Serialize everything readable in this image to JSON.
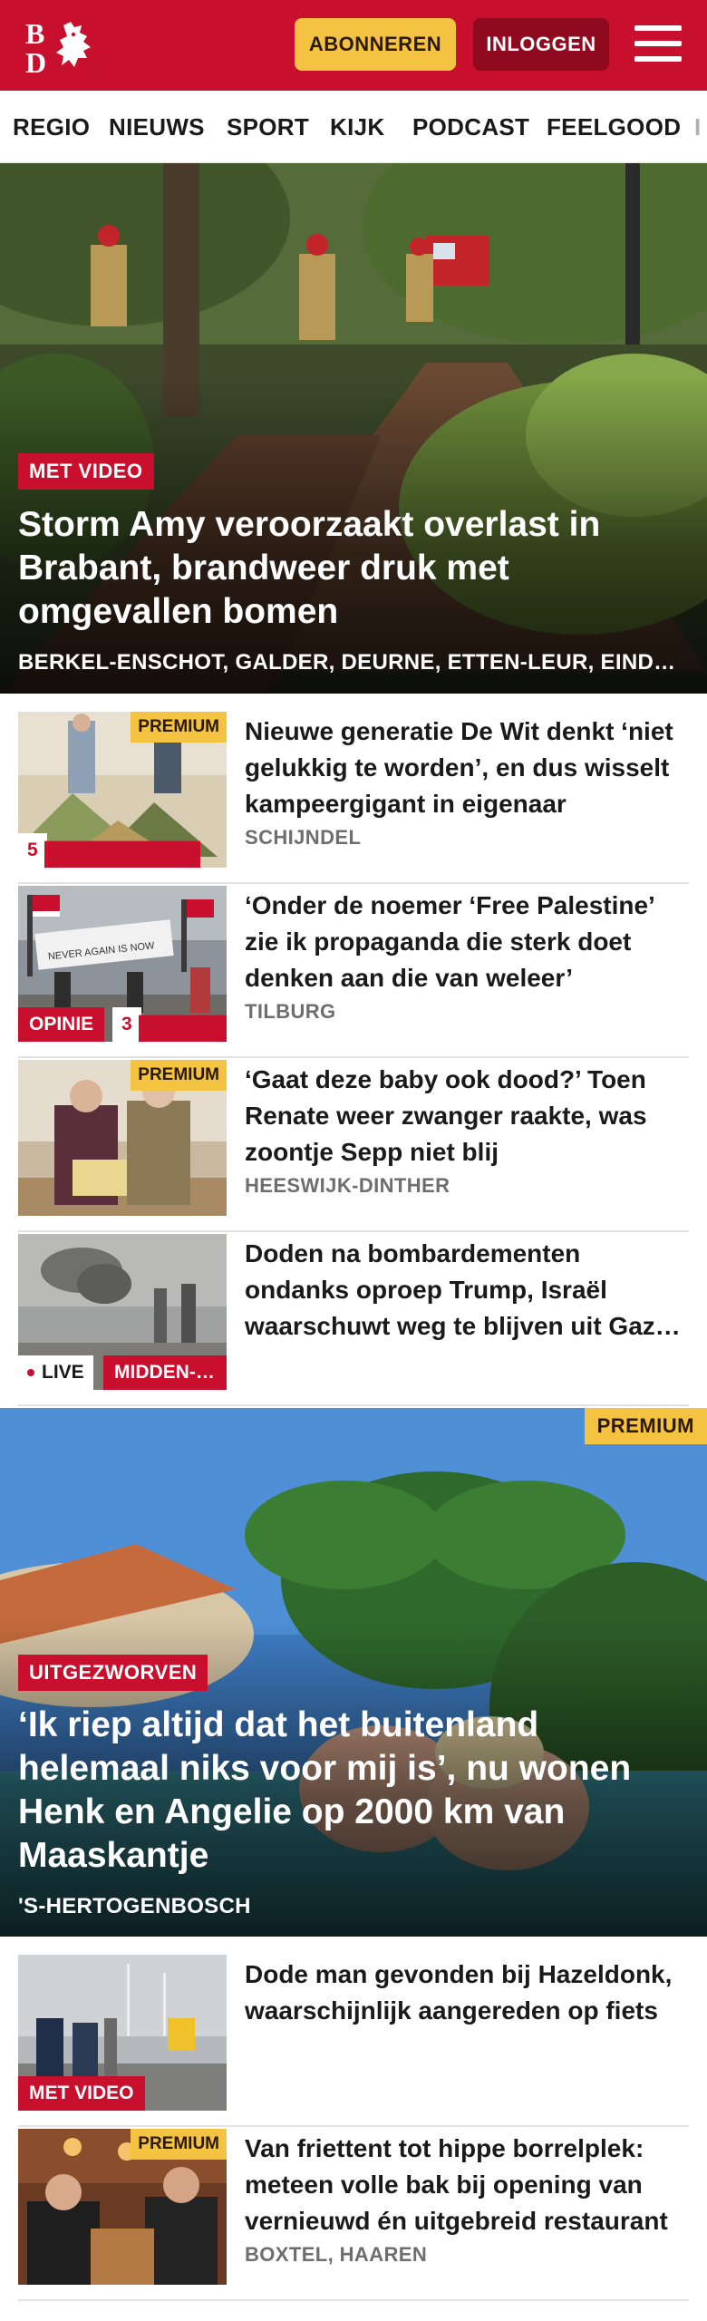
{
  "header": {
    "logo_text": "BD",
    "subscribe_label": "ABONNEREN",
    "login_label": "INLOGGEN"
  },
  "nav": {
    "items": [
      "REGIO",
      "NIEUWS",
      "SPORT",
      "KIJK",
      "PODCAST",
      "FEELGOOD",
      "I"
    ]
  },
  "hero": {
    "label": "MET VIDEO",
    "title": "Storm Amy veroorzaakt overlast in Brabant, brandweer druk met omgevallen bomen",
    "locations": "BERKEL-ENSCHOT, GALDER, DEURNE, ETTEN-LEUR, EINDHOVEN"
  },
  "articles": [
    {
      "title": "Nieuwe generatie De Wit denkt ‘niet gelukkig te worden’, en dus wisselt kampeergigant in eigenaar",
      "location": "SCHIJNDEL",
      "premium": "PREMIUM",
      "comments": "5"
    },
    {
      "title": "‘Onder de noemer ‘Free Palestine’ zie ik propaganda die sterk doet denken aan die van weleer’",
      "location": "TILBURG",
      "tag": "OPINIE",
      "comments": "3"
    },
    {
      "title": "‘Gaat deze baby ook dood?’ Toen Renate weer zwanger raakte, was zoontje Sepp niet blij",
      "location": "HEESWIJK-DINTHER",
      "premium": "PREMIUM"
    },
    {
      "title": "Doden na bombardementen ondanks oproep Trump, Israël waarschuwt weg te blijven uit Gaza-Stad",
      "location": "",
      "live": "LIVE",
      "region": "MIDDEN-OOSTEN"
    }
  ],
  "hero2": {
    "premium": "PREMIUM",
    "label": "UITGEZWORVEN",
    "title": "‘Ik riep altijd dat het buitenland helemaal niks voor mij is’, nu wonen Henk en Angelie op 2000 km van Maaskantje",
    "location": "'S-HERTOGENBOSCH"
  },
  "articles2": [
    {
      "title": "Dode man gevonden bij Hazeldonk, waarschijnlijk aangereden op fiets",
      "location": "",
      "video": "MET VIDEO"
    },
    {
      "title": "Van friettent tot hippe borrelplek: meteen volle bak bij opening van vernieuwd én uitgebreid restaurant",
      "location": "BOXTEL, HAAREN",
      "premium": "PREMIUM"
    }
  ],
  "colors": {
    "brand_red": "#c8102e",
    "premium_yellow": "#f5c342",
    "login_dark_red": "#8f0a1f"
  }
}
